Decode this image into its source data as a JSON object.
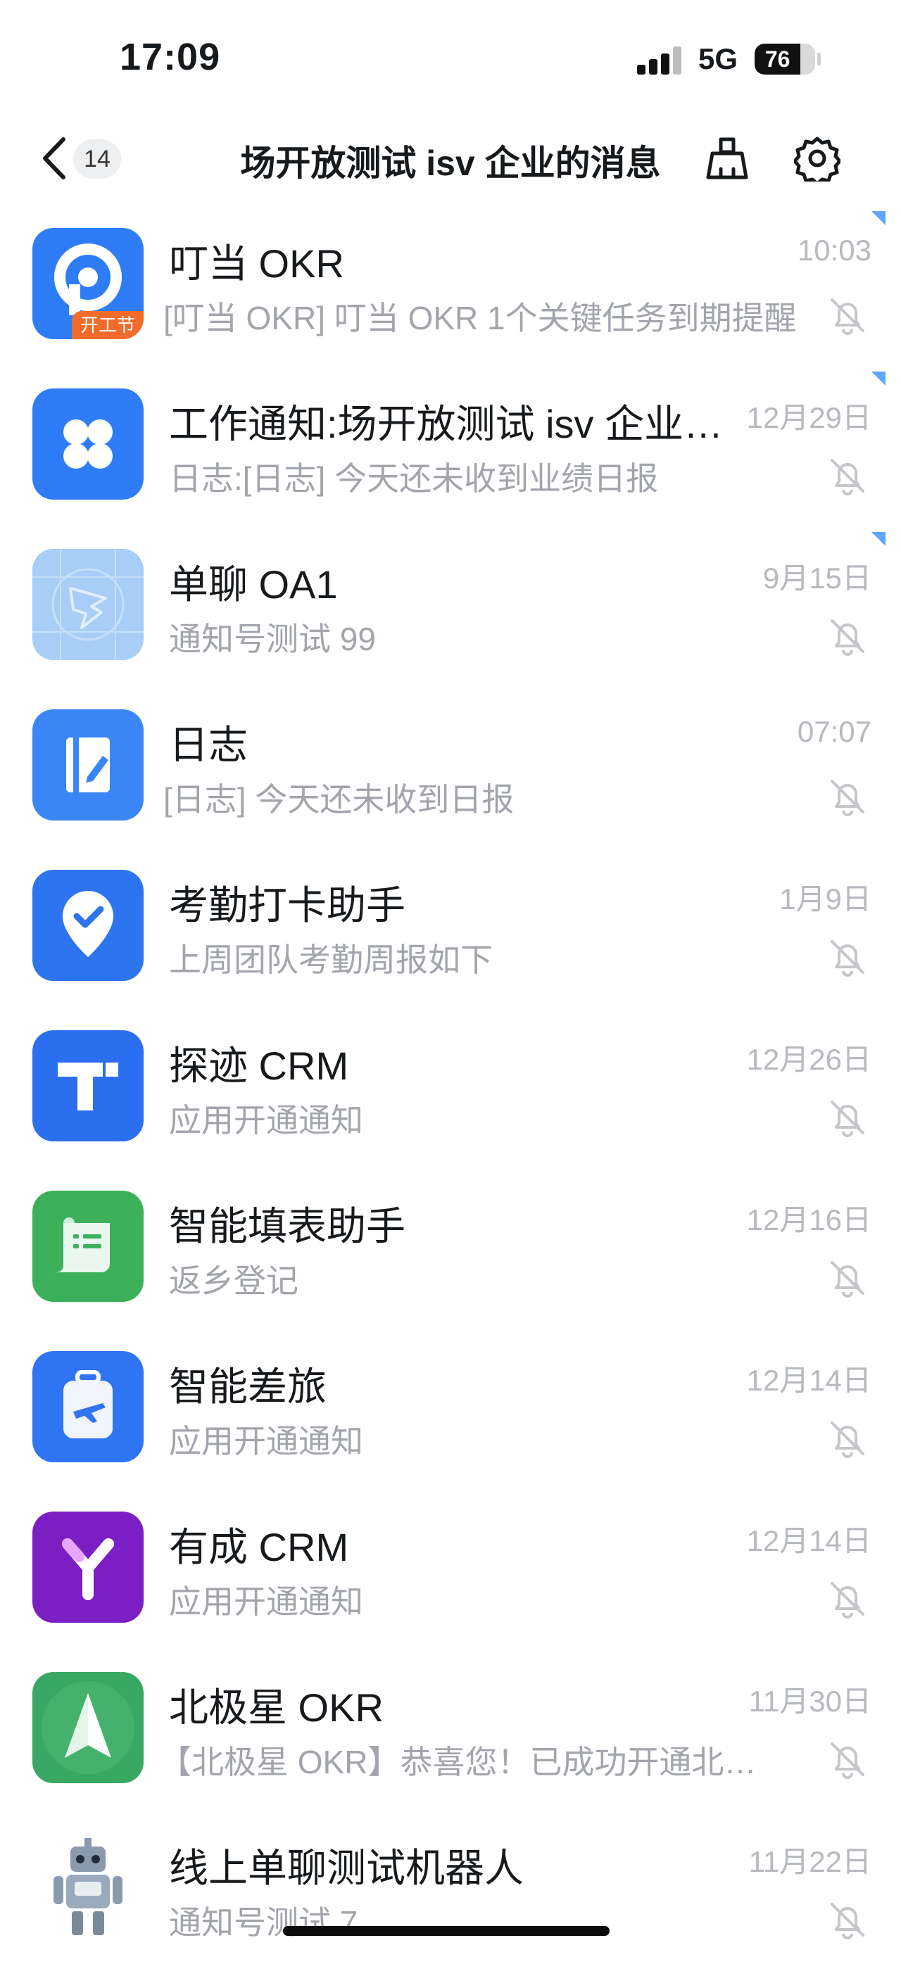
{
  "status_bar": {
    "time": "17:09",
    "network": "5G",
    "battery": "76"
  },
  "nav": {
    "back_count": "14",
    "title": "场开放测试 isv 企业的消息"
  },
  "colors": {
    "accent": "#5ea6ff",
    "muted": "#a2a5ab",
    "time": "#b6b9be"
  },
  "messages": [
    {
      "name": "叮当 OKR",
      "preview": "[叮当 OKR] 叮当 OKR 1个关键任务到期提醒",
      "time": "10:03",
      "tag": "开工节",
      "icon": "dingdang-okr-icon"
    },
    {
      "name": "工作通知:场开放测试 isv 企业 ...",
      "preview": "日志:[日志] 今天还未收到业绩日报",
      "time": "12月29日",
      "icon": "clover-icon"
    },
    {
      "name": "单聊 OA1",
      "preview": "通知号测试 99",
      "time": "9月15日",
      "icon": "dingtalk-placeholder-icon"
    },
    {
      "name": "日志",
      "preview": "[日志] 今天还未收到日报",
      "time": "07:07",
      "icon": "journal-icon"
    },
    {
      "name": "考勤打卡助手",
      "preview": "上周团队考勤周报如下",
      "time": "1月9日",
      "icon": "checkin-pin-icon"
    },
    {
      "name": "探迹 CRM",
      "preview": "应用开通通知",
      "time": "12月26日",
      "icon": "tanji-crm-icon"
    },
    {
      "name": "智能填表助手",
      "preview": "返乡登记",
      "time": "12月16日",
      "icon": "form-scroll-icon"
    },
    {
      "name": "智能差旅",
      "preview": "应用开通通知",
      "time": "12月14日",
      "icon": "travel-suitcase-icon"
    },
    {
      "name": "有成 CRM",
      "preview": "应用开通通知",
      "time": "12月14日",
      "icon": "youcheng-crm-icon"
    },
    {
      "name": "北极星 OKR",
      "preview": "【北极星 OKR】恭喜您！已成功开通北极星 OKR",
      "time": "11月30日",
      "icon": "polaris-arrow-icon"
    },
    {
      "name": "线上单聊测试机器人",
      "preview": "通知号测试 7",
      "time": "11月22日",
      "icon": "robot-icon"
    }
  ]
}
